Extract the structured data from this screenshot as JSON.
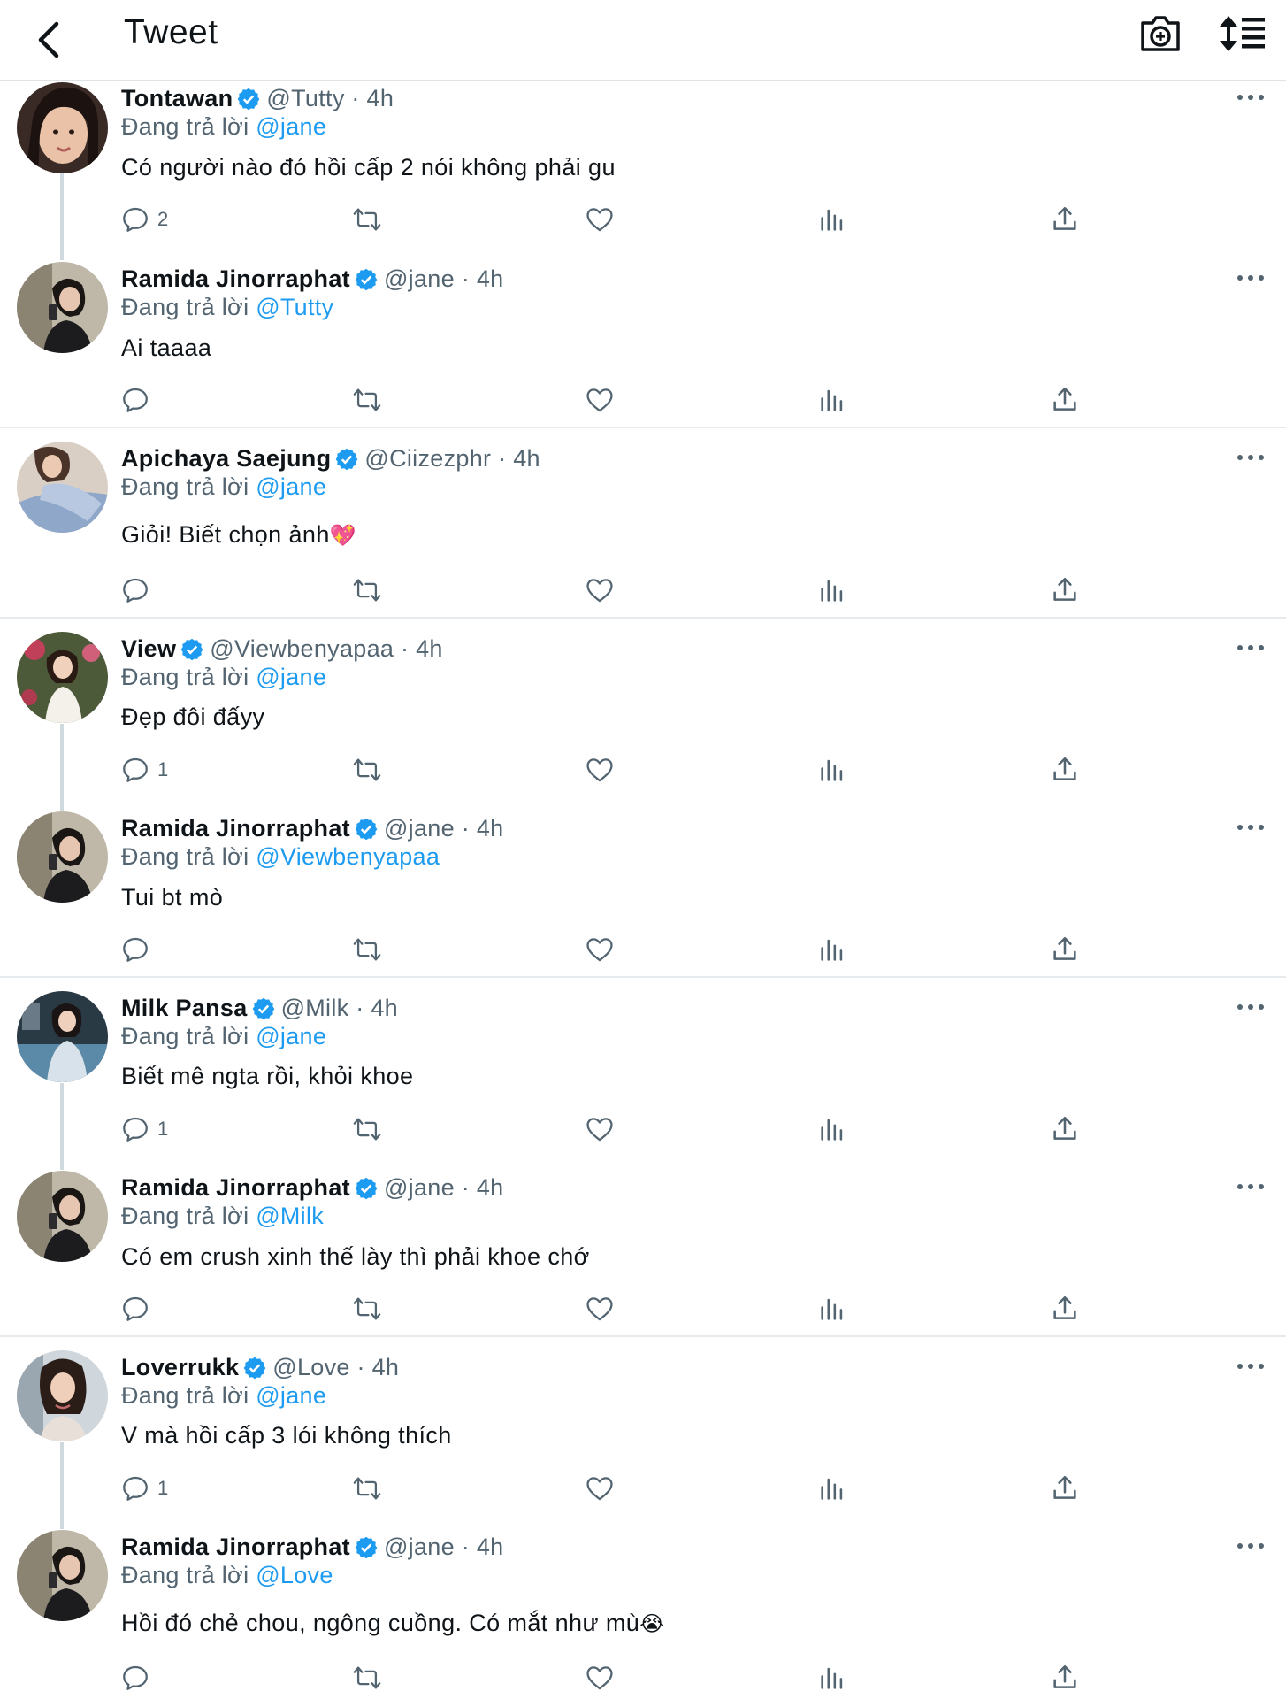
{
  "header": {
    "title": "Tweet",
    "back_icon": "back-arrow-icon",
    "camera_icon": "camera-icon",
    "sort_icon": "sort-icon"
  },
  "colors": {
    "accent": "#1d9bf0",
    "text": "#0f1419",
    "muted": "#536471",
    "divider": "#e7eaec"
  },
  "reply_prefix": "Đang trả lời",
  "tweets": [
    {
      "name": "Tontawan",
      "meta": "@Tutty · 4h",
      "reply_to": "@jane",
      "text": "Có người nào đó hồi cấp 2 nói không phải gu",
      "emoji": "",
      "replies": "2"
    },
    {
      "name": "Ramida Jinorraphat",
      "meta": "@jane · 4h",
      "reply_to": "@Tutty",
      "text": "Ai taaaa",
      "emoji": "",
      "replies": ""
    },
    {
      "name": "Apichaya Saejung",
      "meta": "@Ciizezphr · 4h",
      "reply_to": "@jane",
      "text": "Giỏi! Biết chọn ảnh",
      "emoji": "💖",
      "replies": ""
    },
    {
      "name": "View",
      "meta": "@Viewbenyapaa · 4h",
      "reply_to": "@jane",
      "text": "Đẹp đôi đấyy",
      "emoji": "",
      "replies": "1"
    },
    {
      "name": "Ramida Jinorraphat",
      "meta": "@jane · 4h",
      "reply_to": "@Viewbenyapaa",
      "text": "Tui bt mò",
      "emoji": "",
      "replies": ""
    },
    {
      "name": "Milk Pansa",
      "meta": "@Milk · 4h",
      "reply_to": "@jane",
      "text": "Biết mê ngta rồi, khỏi khoe",
      "emoji": "",
      "replies": "1"
    },
    {
      "name": "Ramida Jinorraphat",
      "meta": "@jane · 4h",
      "reply_to": "@Milk",
      "text": "Có em crush xinh thế lày thì phải khoe chớ",
      "emoji": "",
      "replies": ""
    },
    {
      "name": "Loverrukk",
      "meta": "@Love · 4h",
      "reply_to": "@jane",
      "text": "V mà hồi cấp 3 lói không thích",
      "emoji": "",
      "replies": "1"
    },
    {
      "name": "Ramida Jinorraphat",
      "meta": "@jane · 4h",
      "reply_to": "@Love",
      "text": "Hồi đó chẻ chou, ngông cuồng. Có mắt như mù",
      "emoji": "😭",
      "replies": ""
    }
  ],
  "action_icons": [
    "reply-icon",
    "retweet-icon",
    "like-icon",
    "views-icon",
    "share-icon"
  ]
}
